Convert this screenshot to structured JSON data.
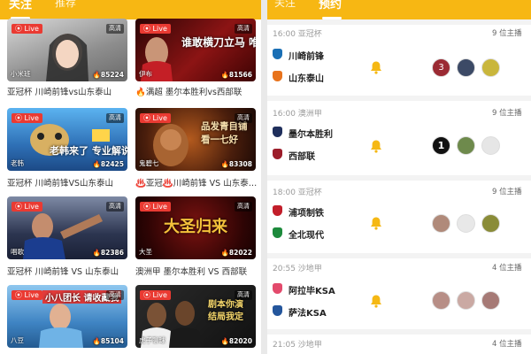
{
  "left": {
    "tabs": [
      {
        "label": "关注"
      },
      {
        "label": "推荐"
      }
    ],
    "streams": [
      {
        "live": "Live",
        "hd": "高清",
        "category": "小米班",
        "heat": "85224",
        "title": "亚冠杯 川崎前锋vs山东泰山",
        "text": ""
      },
      {
        "live": "Live",
        "hd": "高清",
        "category": "伊布",
        "heat": "81566",
        "title": "🔥满超 墨尔本胜利vs西部联",
        "text": "谁敢横刀立马 唯我大帝克"
      },
      {
        "live": "Live",
        "hd": "高清",
        "category": "老韩",
        "heat": "82425",
        "title": "亚冠杯 川崎前锋VS山东泰山",
        "text": "老韩来了 专业解说"
      },
      {
        "live": "Live",
        "hd": "高清",
        "category": "鬼碧七",
        "heat": "83308",
        "title": "♨️亚冠♨️川崎前锋 VS 山东泰…",
        "text": "品发青目铺 看一七好"
      },
      {
        "live": "Live",
        "hd": "高清",
        "category": "唱歌",
        "heat": "82386",
        "title": "亚冠杯 川崎前锋 VS 山东泰山",
        "text": ""
      },
      {
        "live": "Live",
        "hd": "高清",
        "category": "大圣",
        "heat": "82022",
        "title": "澳洲甲 墨尔本胜利 VS 西部联",
        "text": "大圣归来"
      },
      {
        "live": "Live",
        "hd": "高清",
        "category": "八豆",
        "heat": "85104",
        "title": "",
        "text": "小八团长 请收藏我"
      },
      {
        "live": "Live",
        "hd": "高清",
        "category": "虎子聊球",
        "heat": "82020",
        "title": "",
        "text": "剧本你演 结局我定"
      }
    ]
  },
  "right": {
    "tabs": [
      {
        "label": "关注"
      },
      {
        "label": "预约"
      }
    ],
    "matches": [
      {
        "time_league": "16:00 亚冠杯",
        "anchors": "9 位主播",
        "home": "川崎前锋",
        "away": "山东泰山",
        "home_color": "#1a6fb5",
        "away_color": "#e8731c"
      },
      {
        "time_league": "16:00 澳洲甲",
        "anchors": "9 位主播",
        "home": "墨尔本胜利",
        "away": "西部联",
        "home_color": "#1f2f5c",
        "away_color": "#9c1d2a"
      },
      {
        "time_league": "18:00 亚冠杯",
        "anchors": "9 位主播",
        "home": "浦项制铁",
        "away": "全北现代",
        "home_color": "#c21e2a",
        "away_color": "#1d8a3c"
      },
      {
        "time_league": "20:55 沙地甲",
        "anchors": "4 位主播",
        "home": "阿拉毕KSA",
        "away": "萨法KSA",
        "home_color": "#e34a6c",
        "away_color": "#24569c"
      },
      {
        "time_league": "21:05 沙地甲",
        "anchors": "4 位主播",
        "home": "",
        "away": "",
        "home_color": "#cccccc",
        "away_color": "#cccccc"
      }
    ]
  },
  "colors": {
    "brand": "#f7b713",
    "live": "#ea3a32"
  }
}
